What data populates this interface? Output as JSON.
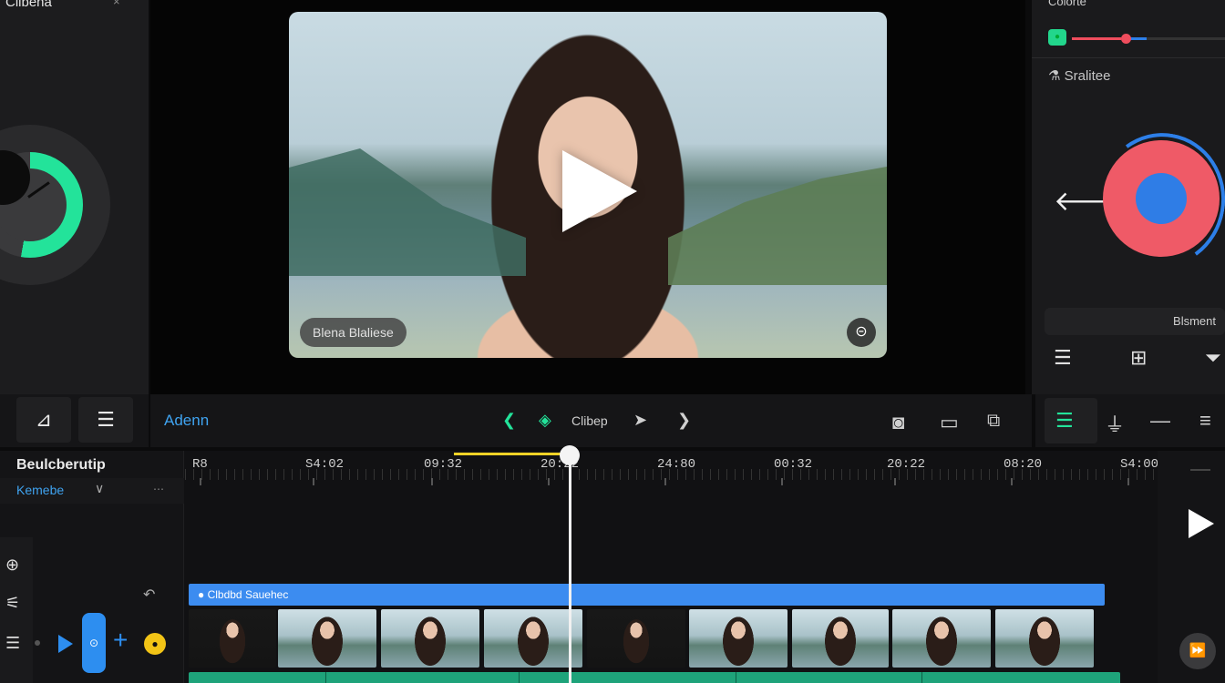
{
  "left_panel": {
    "title": "Clibena",
    "close": "×"
  },
  "right_panel": {
    "title": "Colorte",
    "section": "Sralitee",
    "preset": "Blsment"
  },
  "video": {
    "caption": "Blena Blaliese",
    "badge": "⊝"
  },
  "toolbar": {
    "brand": "Adenn",
    "clip_label": "Clibep"
  },
  "timeline": {
    "track_title": "Beulcberutip",
    "track_sub": "Kemebe",
    "caption_track": "● Clbdbd  Sauehec",
    "ruler": [
      "R8",
      "S4:02",
      "09:32",
      "20:22",
      "24:80",
      "00:32",
      "20:22",
      "08:20",
      "S4:00"
    ]
  },
  "icons": {
    "left_tool_1": "chart-icon",
    "left_tool_2": "list-icon",
    "prev": "chevron-left-icon",
    "center": "diamond-icon",
    "next": "arrow-right-icon",
    "forward": "chevron-right-icon",
    "snapshot": "camera-icon",
    "window": "window-icon",
    "crop": "crop-icon"
  },
  "colors": {
    "accent_blue": "#2d8ef0",
    "accent_green": "#23e39a",
    "playhead": "#f5d327",
    "wheel_red": "#ef5a67"
  }
}
